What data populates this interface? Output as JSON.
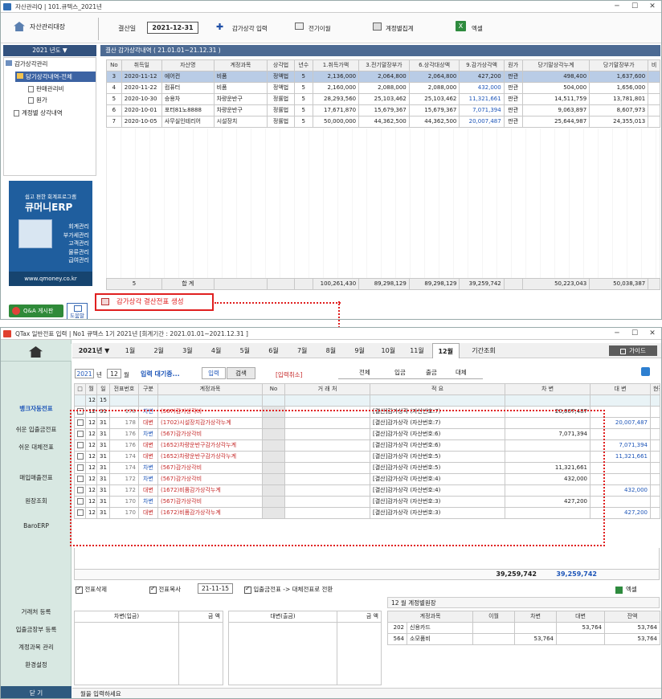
{
  "win1": {
    "title": "자산관리Q | 101.큐텍스_2021년",
    "tool_manage": "자산관리대장",
    "close_date_label": "결산일",
    "close_date": "2021-12-31",
    "btn_input": "감가상각 입력",
    "btn_transfer": "전기이월",
    "btn_account_sum": "계정별집계",
    "btn_excel": "엑셀",
    "year_selector": "2021 년도 ▼",
    "section_title": "결산 감가상각내역 ( 21.01.01~21.12.31 )",
    "tree": [
      "감가상각관리",
      "당기상각내역-전체",
      "판매관리비",
      "원가",
      "계정별 상각내역"
    ],
    "ad": {
      "top": "쉽고 편한 회계프로그램",
      "brand": "큐머니ERP",
      "items": [
        "회계관리",
        "부가세관리",
        "고객관리",
        "물류관리",
        "급여관리"
      ],
      "url": "www.qmoney.co.kr"
    },
    "qa_label": "Q&A 게시판",
    "help_label": "도움말",
    "columns": [
      "No",
      "취득일",
      "자산명",
      "계정과목",
      "상각법",
      "년수",
      "1.취득가액",
      "3.전기말장부가",
      "6.상각대상액",
      "9.감가상각액",
      "원가",
      "당기말상각누계",
      "당기말장부가",
      "비"
    ],
    "rows": [
      [
        "3",
        "2020-11-12",
        "에어컨",
        "비품",
        "정액법",
        "5",
        "2,136,000",
        "2,064,800",
        "2,064,800",
        "427,200",
        "판관",
        "498,400",
        "1,637,600"
      ],
      [
        "4",
        "2020-11-22",
        "컴퓨터",
        "비품",
        "정액법",
        "5",
        "2,160,000",
        "2,088,000",
        "2,088,000",
        "432,000",
        "판관",
        "504,000",
        "1,656,000"
      ],
      [
        "5",
        "2020-10-30",
        "승용차",
        "차량운반구",
        "정률법",
        "5",
        "28,293,560",
        "25,103,462",
        "25,103,462",
        "11,321,661",
        "판관",
        "14,511,759",
        "13,781,801"
      ],
      [
        "6",
        "2020-10-01",
        "포터81노8888",
        "차량운반구",
        "정률법",
        "5",
        "17,671,870",
        "15,679,367",
        "15,679,367",
        "7,071,394",
        "판관",
        "9,063,897",
        "8,607,973"
      ],
      [
        "7",
        "2020-10-05",
        "사무실인테리어",
        "시설장치",
        "정률법",
        "5",
        "50,000,000",
        "44,362,500",
        "44,362,500",
        "20,007,487",
        "판관",
        "25,644,987",
        "24,355,013"
      ]
    ],
    "total": [
      "5",
      "합 계",
      "",
      "",
      "",
      "100,261,430",
      "89,298,129",
      "89,298,129",
      "39,259,742",
      "",
      "50,223,043",
      "50,038,387"
    ],
    "generate_label": "감가상각 결산전표 생성"
  },
  "win2": {
    "title": "QTax 일반전표 입력 | No1 큐텍스 1기 2021년 [회계기간 : 2021.01.01~2021.12.31 ]",
    "year_menu": "2021년 ▼",
    "months": [
      "1월",
      "2월",
      "3월",
      "4월",
      "5월",
      "6월",
      "7월",
      "8월",
      "9월",
      "10월",
      "11월",
      "12월"
    ],
    "period": "기간조회",
    "guide": "가이드",
    "sidebar": [
      "뱅크자동전표",
      "쉬운 입출금전표",
      "쉬운 대체전표",
      "매입매출전표",
      "원장조회",
      "BaroERP",
      "거래처 등록",
      "입출금장부 등록",
      "계정과목 관리",
      "환경설정"
    ],
    "close": "닫 기",
    "year": "2021",
    "year_unit": "년",
    "month": "12",
    "month_unit": "월",
    "pending": "입력 대기중...",
    "tab_input": "입력",
    "tab_search": "검색",
    "cancel_input": "[입력취소]",
    "filters": [
      "전체",
      "입금",
      "출금",
      "대체"
    ],
    "columns": [
      "□",
      "월",
      "일",
      "전표번호",
      "구분",
      "계정과목",
      "No",
      "거 래 처",
      "적 요",
      "차 변",
      "대 변",
      "현장"
    ],
    "entry_month": "12",
    "entry_day": "15",
    "rows": [
      [
        "12",
        "31",
        "178",
        "차변",
        "(567)감가상각비",
        "[결산]감가상각 (자산번호:7)",
        "20,007,487",
        ""
      ],
      [
        "12",
        "31",
        "178",
        "대변",
        "(1702)시설장치감가상각누계",
        "[결산]감가상각 (자산번호:7)",
        "",
        "20,007,487"
      ],
      [
        "12",
        "31",
        "176",
        "차변",
        "(567)감가상각비",
        "[결산]감가상각 (자산번호:6)",
        "7,071,394",
        ""
      ],
      [
        "12",
        "31",
        "176",
        "대변",
        "(1652)차량운반구감가상각누계",
        "[결산]감가상각 (자산번호:6)",
        "",
        "7,071,394"
      ],
      [
        "12",
        "31",
        "174",
        "대변",
        "(1652)차량운반구감가상각누계",
        "[결산]감가상각 (자산번호:5)",
        "",
        "11,321,661"
      ],
      [
        "12",
        "31",
        "174",
        "차변",
        "(567)감가상각비",
        "[결산]감가상각 (자산번호:5)",
        "11,321,661",
        ""
      ],
      [
        "12",
        "31",
        "172",
        "차변",
        "(567)감가상각비",
        "[결산]감가상각 (자산번호:4)",
        "432,000",
        ""
      ],
      [
        "12",
        "31",
        "172",
        "대변",
        "(1672)비품감가상각누계",
        "[결산]감가상각 (자산번호:4)",
        "",
        "432,000"
      ],
      [
        "12",
        "31",
        "170",
        "차변",
        "(567)감가상각비",
        "[결산]감가상각 (자산번호:3)",
        "427,200",
        ""
      ],
      [
        "12",
        "31",
        "170",
        "대변",
        "(1672)비품감가상각누계",
        "[결산]감가상각 (자산번호:3)",
        "",
        "427,200"
      ]
    ],
    "sum_debit": "39,259,742",
    "sum_credit": "39,259,742",
    "opt_delete": "전표삭제",
    "opt_copy": "전표복사",
    "copy_date": "21-11-15",
    "opt_convert": "입출금전표 -> 대체전표로 전환",
    "excel": "엑셀",
    "debit_box": [
      "차변(입금)",
      "금 액"
    ],
    "credit_box": [
      "대변(출금)",
      "금 액"
    ],
    "ledger_title": "12 월  계정별원장",
    "ledger_cols": [
      "계정과목",
      "이월",
      "차변",
      "대변",
      "잔액"
    ],
    "ledger_rows": [
      [
        "202",
        "신용카드",
        "",
        "",
        "53,764",
        "53,764"
      ],
      [
        "564",
        "소모품비",
        "",
        "53,764",
        "",
        "53,764"
      ]
    ],
    "status": "월을 입력하세요"
  }
}
